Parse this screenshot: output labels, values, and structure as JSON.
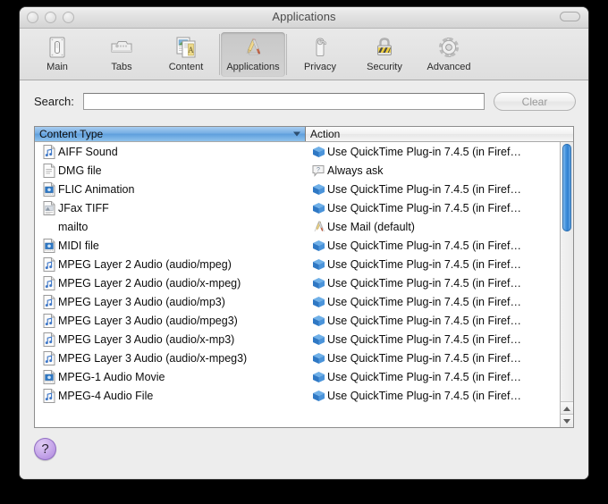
{
  "window": {
    "title": "Applications",
    "traffic_lights": [
      "close",
      "minimize",
      "zoom"
    ],
    "toolbar_toggle": "toolbar-toggle"
  },
  "toolbar": {
    "items": [
      {
        "label": "Main",
        "icon": "switch-icon",
        "selected": false
      },
      {
        "label": "Tabs",
        "icon": "tabs-icon",
        "selected": false
      },
      {
        "label": "Content",
        "icon": "content-documents-icon",
        "selected": false
      },
      {
        "label": "Applications",
        "icon": "applications-art-icon",
        "selected": true
      },
      {
        "label": "Privacy",
        "icon": "door-hanger-icon",
        "selected": false
      },
      {
        "label": "Security",
        "icon": "padlock-icon",
        "selected": false
      },
      {
        "label": "Advanced",
        "icon": "gear-icon",
        "selected": false
      }
    ]
  },
  "search": {
    "label": "Search:",
    "value": "",
    "placeholder": "",
    "clear_label": "Clear"
  },
  "list": {
    "columns": [
      {
        "label": "Content Type",
        "sorted": true,
        "sort_direction": "descending"
      },
      {
        "label": "Action",
        "sorted": false
      }
    ],
    "rows": [
      {
        "type": "AIFF Sound",
        "type_icon": "audio-file-icon",
        "action": "Use QuickTime Plug-in 7.4.5 (in Firef…",
        "action_icon": "plugin-icon"
      },
      {
        "type": "DMG file",
        "type_icon": "generic-file-icon",
        "action": "Always ask",
        "action_icon": "always-ask-icon"
      },
      {
        "type": "FLIC Animation",
        "type_icon": "movie-file-icon",
        "action": "Use QuickTime Plug-in 7.4.5 (in Firef…",
        "action_icon": "plugin-icon"
      },
      {
        "type": "JFax TIFF",
        "type_icon": "image-file-icon",
        "action": "Use QuickTime Plug-in 7.4.5 (in Firef…",
        "action_icon": "plugin-icon"
      },
      {
        "type": "mailto",
        "type_icon": "none",
        "action": "Use Mail (default)",
        "action_icon": "mail-app-icon"
      },
      {
        "type": "MIDI file",
        "type_icon": "movie-file-icon",
        "action": "Use QuickTime Plug-in 7.4.5 (in Firef…",
        "action_icon": "plugin-icon"
      },
      {
        "type": "MPEG Layer 2 Audio (audio/mpeg)",
        "type_icon": "audio-file-icon",
        "action": "Use QuickTime Plug-in 7.4.5 (in Firef…",
        "action_icon": "plugin-icon"
      },
      {
        "type": "MPEG Layer 2 Audio (audio/x-mpeg)",
        "type_icon": "audio-file-icon",
        "action": "Use QuickTime Plug-in 7.4.5 (in Firef…",
        "action_icon": "plugin-icon"
      },
      {
        "type": "MPEG Layer 3 Audio (audio/mp3)",
        "type_icon": "audio-file-icon",
        "action": "Use QuickTime Plug-in 7.4.5 (in Firef…",
        "action_icon": "plugin-icon"
      },
      {
        "type": "MPEG Layer 3 Audio (audio/mpeg3)",
        "type_icon": "audio-file-icon",
        "action": "Use QuickTime Plug-in 7.4.5 (in Firef…",
        "action_icon": "plugin-icon"
      },
      {
        "type": "MPEG Layer 3 Audio (audio/x-mp3)",
        "type_icon": "audio-file-icon",
        "action": "Use QuickTime Plug-in 7.4.5 (in Firef…",
        "action_icon": "plugin-icon"
      },
      {
        "type": "MPEG Layer 3 Audio (audio/x-mpeg3)",
        "type_icon": "audio-file-icon",
        "action": "Use QuickTime Plug-in 7.4.5 (in Firef…",
        "action_icon": "plugin-icon"
      },
      {
        "type": "MPEG-1 Audio Movie",
        "type_icon": "movie-file-icon",
        "action": "Use QuickTime Plug-in 7.4.5 (in Firef…",
        "action_icon": "plugin-icon"
      },
      {
        "type": "MPEG-4 Audio File",
        "type_icon": "audio-file-icon",
        "action": "Use QuickTime Plug-in 7.4.5 (in Firef…",
        "action_icon": "plugin-icon"
      }
    ],
    "scrollbar": {
      "up_arrow": "scroll-up-arrow",
      "down_arrow": "scroll-down-arrow"
    }
  },
  "help": {
    "label": "?"
  },
  "colors": {
    "sorted_header_blue": "#76aee4",
    "scrollbar_thumb_blue": "#4a98e0",
    "plugin_icon_blue": "#3f8fd8",
    "help_purple": "#c3a3e8",
    "window_background": "#ededed"
  }
}
